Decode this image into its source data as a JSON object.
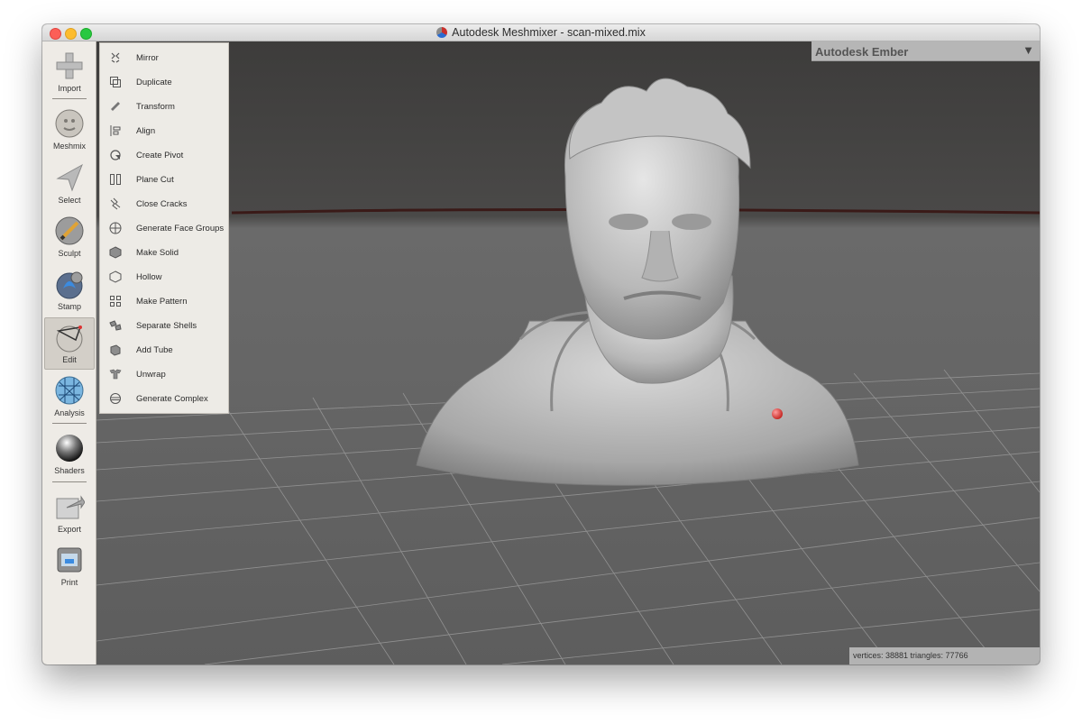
{
  "window": {
    "title": "Autodesk Meshmixer - scan-mixed.mix"
  },
  "toolbar": {
    "tools": [
      {
        "label": "Import",
        "icon": "plus-icon"
      },
      {
        "label": "Meshmix",
        "icon": "meshmix-icon"
      },
      {
        "label": "Select",
        "icon": "select-arrow-icon"
      },
      {
        "label": "Sculpt",
        "icon": "sculpt-brush-icon"
      },
      {
        "label": "Stamp",
        "icon": "stamp-icon"
      },
      {
        "label": "Edit",
        "icon": "edit-icon",
        "active": true
      },
      {
        "label": "Analysis",
        "icon": "analysis-icon"
      },
      {
        "label": "Shaders",
        "icon": "shaders-sphere-icon"
      },
      {
        "label": "Export",
        "icon": "export-icon"
      },
      {
        "label": "Print",
        "icon": "print-icon"
      }
    ]
  },
  "edit_menu": {
    "items": [
      {
        "label": "Mirror",
        "icon": "mirror-icon"
      },
      {
        "label": "Duplicate",
        "icon": "duplicate-icon"
      },
      {
        "label": "Transform",
        "icon": "transform-icon"
      },
      {
        "label": "Align",
        "icon": "align-icon"
      },
      {
        "label": "Create Pivot",
        "icon": "pivot-icon"
      },
      {
        "label": "Plane Cut",
        "icon": "plane-cut-icon"
      },
      {
        "label": "Close Cracks",
        "icon": "close-cracks-icon"
      },
      {
        "label": "Generate Face Groups",
        "icon": "face-groups-icon"
      },
      {
        "label": "Make Solid",
        "icon": "make-solid-icon"
      },
      {
        "label": "Hollow",
        "icon": "hollow-icon"
      },
      {
        "label": "Make Pattern",
        "icon": "make-pattern-icon"
      },
      {
        "label": "Separate Shells",
        "icon": "separate-shells-icon"
      },
      {
        "label": "Add Tube",
        "icon": "add-tube-icon"
      },
      {
        "label": "Unwrap",
        "icon": "unwrap-icon"
      },
      {
        "label": "Generate Complex",
        "icon": "generate-complex-icon"
      }
    ]
  },
  "printer_dropdown": {
    "label": "Autodesk Ember",
    "arrow": "▼"
  },
  "status": {
    "text": "vertices: 38881  triangles: 77766"
  },
  "scene": {
    "object": "3D scanned bust of a bearded man",
    "marker_color": "#e53935"
  }
}
